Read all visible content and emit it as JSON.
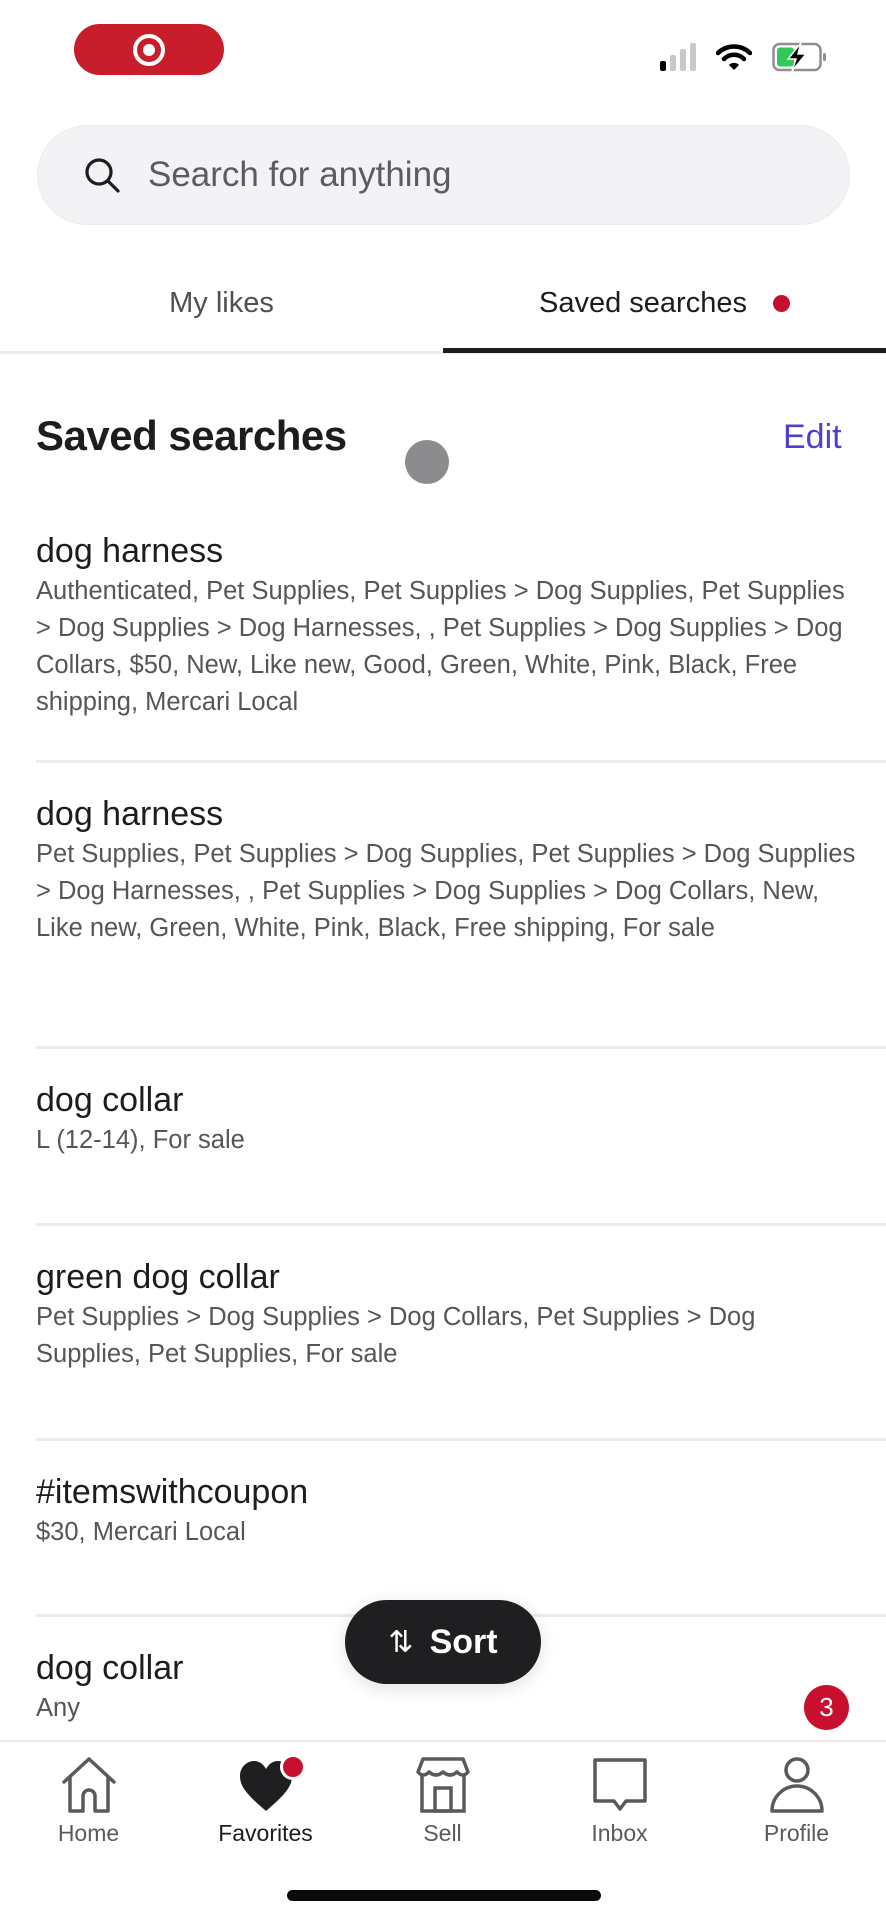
{
  "status_bar": {
    "recording_indicator": "screen-recording",
    "signal_bars_active": 1,
    "signal_bars_total": 4,
    "wifi": "wifi-icon",
    "battery": "battery-charging-icon"
  },
  "search": {
    "placeholder": "Search for anything",
    "value": ""
  },
  "tabs": [
    {
      "label": "My likes",
      "active": false
    },
    {
      "label": "Saved searches",
      "active": true,
      "has_dot": true
    }
  ],
  "section": {
    "title": "Saved searches",
    "edit_label": "Edit"
  },
  "saved_searches": [
    {
      "title": "dog harness",
      "filters": "Authenticated, Pet Supplies, Pet Supplies > Dog Supplies, Pet Supplies > Dog Supplies > Dog Harnesses, , Pet Supplies > Dog Supplies > Dog Collars, $50, New, Like new, Good, Green, White, Pink, Black, Free shipping, Mercari Local"
    },
    {
      "title": "dog harness",
      "filters": "Pet Supplies, Pet Supplies > Dog Supplies, Pet Supplies > Dog Supplies > Dog Harnesses, , Pet Supplies > Dog Supplies > Dog Collars, New, Like new, Green, White, Pink, Black, Free shipping, For sale"
    },
    {
      "title": "dog collar",
      "filters": "L (12-14), For sale"
    },
    {
      "title": "green dog collar",
      "filters": "Pet Supplies > Dog Supplies > Dog Collars, Pet Supplies > Dog Supplies, Pet Supplies, For sale"
    },
    {
      "title": "#itemswithcoupon",
      "filters": "$30, Mercari Local"
    },
    {
      "title": "dog collar",
      "filters": "Any"
    }
  ],
  "sort": {
    "icon": "⇅",
    "label": "Sort"
  },
  "floating_badge": {
    "count": "3"
  },
  "bottom_nav": [
    {
      "label": "Home",
      "icon": "home-icon",
      "active": false
    },
    {
      "label": "Favorites",
      "icon": "heart-icon",
      "active": true,
      "has_dot": true
    },
    {
      "label": "Sell",
      "icon": "storefront-icon",
      "active": false
    },
    {
      "label": "Inbox",
      "icon": "chat-bubble-icon",
      "active": false
    },
    {
      "label": "Profile",
      "icon": "person-icon",
      "active": false
    }
  ],
  "colors": {
    "brand_red": "#c8102e",
    "link_purple": "#4f3fd0",
    "text_primary": "#1d1d1f",
    "text_secondary": "#55555a"
  }
}
